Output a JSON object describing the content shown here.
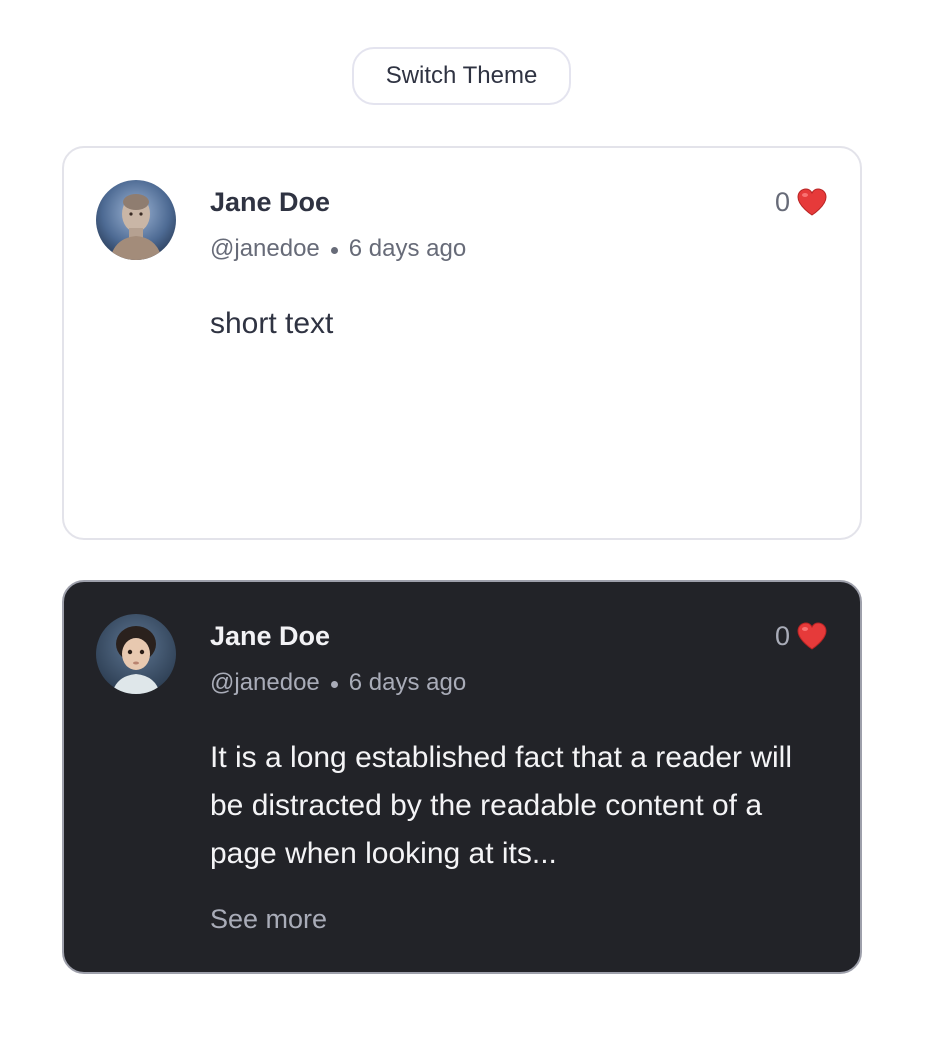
{
  "toolbar": {
    "switch_theme_label": "Switch Theme"
  },
  "cards": [
    {
      "theme": "light",
      "author_name": "Jane Doe",
      "handle": "@janedoe",
      "time_ago": "6 days ago",
      "likes": "0",
      "text": "short text",
      "avatar_icon": "user-photo-man"
    },
    {
      "theme": "dark",
      "author_name": "Jane Doe",
      "handle": "@janedoe",
      "time_ago": "6 days ago",
      "likes": "0",
      "text": "It is a long established fact that a reader will be distracted by the readable content of a page when looking at its...",
      "see_more_label": "See more",
      "avatar_icon": "user-photo-child"
    }
  ],
  "colors": {
    "light_card_bg": "#ffffff",
    "dark_card_bg": "#222328",
    "heart": "#e63a3a"
  }
}
